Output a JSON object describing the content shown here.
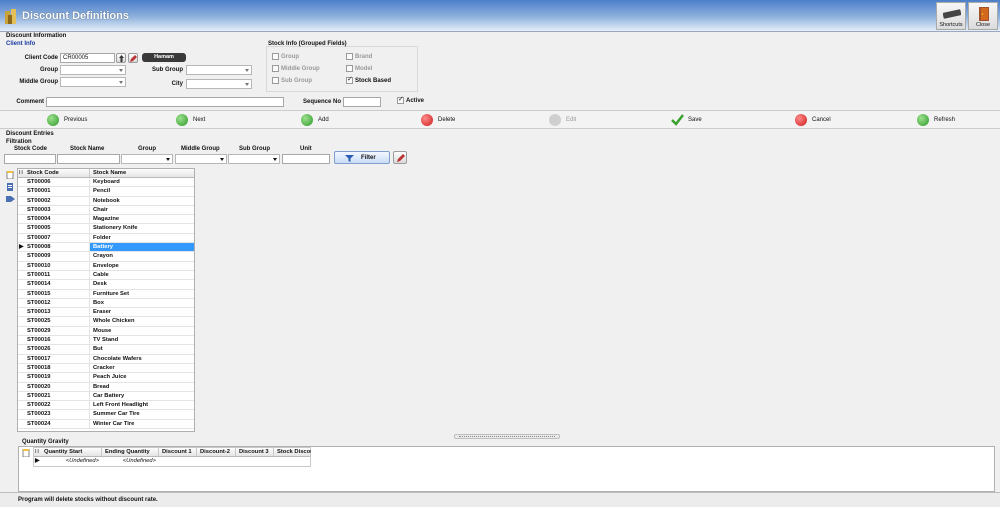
{
  "window": {
    "title": "Discount Definitions"
  },
  "toolbar": {
    "shortcuts_label": "Shortcuts",
    "close_label": "Close"
  },
  "discount_info": {
    "section_label": "Discount Information",
    "client_info_label": "Client Info",
    "client_code_label": "Client Code",
    "client_code_value": "CR00005",
    "client_name_value": "Hamam Cameras",
    "group_label": "Group",
    "middle_group_label": "Middle Group",
    "sub_group_label": "Sub Group",
    "city_label": "City",
    "stock_info_label": "Stock Info (Grouped Fields)",
    "stock_checks": [
      {
        "label": "Group",
        "checked": false
      },
      {
        "label": "Middle Group",
        "checked": false
      },
      {
        "label": "Sub Group",
        "checked": false
      },
      {
        "label": "Brand",
        "checked": false
      },
      {
        "label": "Model",
        "checked": false
      },
      {
        "label": "Stock Based",
        "checked": true
      }
    ],
    "comment_label": "Comment",
    "comment_value": "",
    "sequence_label": "Sequence No",
    "sequence_value": "",
    "active_label": "Active",
    "active_checked": true
  },
  "actions": {
    "previous": "Previous",
    "next": "Next",
    "add": "Add",
    "delete": "Delete",
    "edit": "Edit",
    "save": "Save",
    "cancel": "Cancel",
    "refresh": "Refresh"
  },
  "entries": {
    "section_label": "Discount Entries",
    "filtration_label": "Filtration",
    "filter_cols": [
      "Stock Code",
      "Stock Name",
      "Group",
      "Middle Group",
      "Sub Group",
      "Unit"
    ],
    "filter_button": "Filter",
    "grid_headers": [
      "Stock Code",
      "Stock Name"
    ],
    "rows": [
      [
        "ST00006",
        "Keyboard"
      ],
      [
        "ST00001",
        "Pencil"
      ],
      [
        "ST00002",
        "Notebook"
      ],
      [
        "ST00003",
        "Chair"
      ],
      [
        "ST00004",
        "Magazine"
      ],
      [
        "ST00005",
        "Stationery Knife"
      ],
      [
        "ST00007",
        "Folder"
      ],
      [
        "ST00008",
        "Battery"
      ],
      [
        "ST00009",
        "Crayon"
      ],
      [
        "ST00010",
        "Envelope"
      ],
      [
        "ST00011",
        "Cable"
      ],
      [
        "ST00014",
        "Desk"
      ],
      [
        "ST00015",
        "Furniture Set"
      ],
      [
        "ST00012",
        "Box"
      ],
      [
        "ST00013",
        "Eraser"
      ],
      [
        "ST00025",
        "Whole Chicken"
      ],
      [
        "ST00029",
        "Mouse"
      ],
      [
        "ST00016",
        "TV Stand"
      ],
      [
        "ST00026",
        "But"
      ],
      [
        "ST00017",
        "Chocolate Wafers"
      ],
      [
        "ST00018",
        "Cracker"
      ],
      [
        "ST00019",
        "Peach Juice"
      ],
      [
        "ST00020",
        "Bread"
      ],
      [
        "ST00021",
        "Car Battery"
      ],
      [
        "ST00022",
        "Left Front Headlight"
      ],
      [
        "ST00023",
        "Summer Car Tire"
      ],
      [
        "ST00024",
        "Winter Car Tire"
      ]
    ],
    "selected_row": "ST00008"
  },
  "quantity_gravity": {
    "section_label": "Quantity Gravity",
    "headers": [
      "Quantity Start",
      "Ending Quantity",
      "Discount 1",
      "Discount-2",
      "Discount 3",
      "Stock Discount"
    ],
    "row": [
      "<Undefined>",
      "<Undefined>",
      "",
      "",
      "",
      ""
    ]
  },
  "status": {
    "message": "Program will delete stocks without discount rate."
  },
  "colors": {
    "titlebar": "#4c7fc9",
    "selection": "#3399ff"
  }
}
